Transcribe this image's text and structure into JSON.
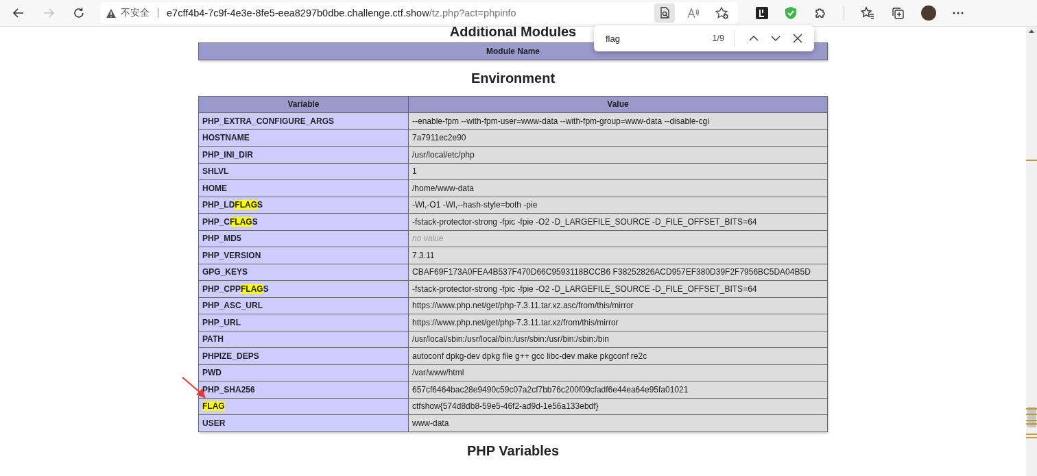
{
  "browser": {
    "nav": [
      {
        "kind": "back",
        "disabled": false
      },
      {
        "kind": "forward",
        "disabled": true
      },
      {
        "kind": "reload",
        "disabled": false
      }
    ],
    "address": {
      "security": "不安全",
      "host": "e7cff4b4-7c9f-4e3e-8fe5-eea8297b0dbe.challenge.ctf.show",
      "path": "/tz.php?act=phpinfo"
    },
    "find_bar": {
      "query": "flag",
      "count": "1/9"
    }
  },
  "page": {
    "cut_heading": "Additional Modules",
    "modules_column": "Module Name",
    "section_title": "Environment",
    "table": {
      "columns": [
        "Variable",
        "Value"
      ],
      "rows": [
        {
          "name": [
            {
              "text": "PHP_EXTRA_CONFIGURE_ARGS",
              "highlighted": false
            }
          ],
          "value": "--enable-fpm --with-fpm-user=www-data --with-fpm-group=www-data --disable-cgi",
          "kind": "text"
        },
        {
          "name": [
            {
              "text": "HOSTNAME",
              "highlighted": false
            }
          ],
          "value": "7a7911ec2e90",
          "kind": "text"
        },
        {
          "name": [
            {
              "text": "PHP_INI_DIR",
              "highlighted": false
            }
          ],
          "value": "/usr/local/etc/php",
          "kind": "text"
        },
        {
          "name": [
            {
              "text": "SHLVL",
              "highlighted": false
            }
          ],
          "value": "1",
          "kind": "text"
        },
        {
          "name": [
            {
              "text": "HOME",
              "highlighted": false
            }
          ],
          "value": "/home/www-data",
          "kind": "text"
        },
        {
          "name": [
            {
              "text": "PHP_LD",
              "highlighted": false
            },
            {
              "text": "FLAG",
              "highlighted": true
            },
            {
              "text": "S",
              "highlighted": false
            }
          ],
          "value": "-Wl,-O1 -Wl,--hash-style=both -pie",
          "kind": "text"
        },
        {
          "name": [
            {
              "text": "PHP_C",
              "highlighted": false
            },
            {
              "text": "FLAG",
              "highlighted": true
            },
            {
              "text": "S",
              "highlighted": false
            }
          ],
          "value": "-fstack-protector-strong -fpic -fpie -O2 -D_LARGEFILE_SOURCE -D_FILE_OFFSET_BITS=64",
          "kind": "text"
        },
        {
          "name": [
            {
              "text": "PHP_MD5",
              "highlighted": false
            }
          ],
          "value": "no value",
          "kind": "no_value"
        },
        {
          "name": [
            {
              "text": "PHP_VERSION",
              "highlighted": false
            }
          ],
          "value": "7.3.11",
          "kind": "text"
        },
        {
          "name": [
            {
              "text": "GPG_KEYS",
              "highlighted": false
            }
          ],
          "value": "CBAF69F173A0FEA4B537F470D66C9593118BCCB6 F38252826ACD957EF380D39F2F7956BC5DA04B5D",
          "kind": "text"
        },
        {
          "name": [
            {
              "text": "PHP_CPP",
              "highlighted": false
            },
            {
              "text": "FLAG",
              "highlighted": true
            },
            {
              "text": "S",
              "highlighted": false
            }
          ],
          "value": "-fstack-protector-strong -fpic -fpie -O2 -D_LARGEFILE_SOURCE -D_FILE_OFFSET_BITS=64",
          "kind": "text"
        },
        {
          "name": [
            {
              "text": "PHP_ASC_URL",
              "highlighted": false
            }
          ],
          "value": "https://www.php.net/get/php-7.3.11.tar.xz.asc/from/this/mirror",
          "kind": "text"
        },
        {
          "name": [
            {
              "text": "PHP_URL",
              "highlighted": false
            }
          ],
          "value": "https://www.php.net/get/php-7.3.11.tar.xz/from/this/mirror",
          "kind": "text"
        },
        {
          "name": [
            {
              "text": "PATH",
              "highlighted": false
            }
          ],
          "value": "/usr/local/sbin:/usr/local/bin:/usr/sbin:/usr/bin:/sbin:/bin",
          "kind": "text"
        },
        {
          "name": [
            {
              "text": "PHPIZE_DEPS",
              "highlighted": false
            }
          ],
          "value": "autoconf dpkg-dev dpkg file g++ gcc libc-dev make pkgconf re2c",
          "kind": "text"
        },
        {
          "name": [
            {
              "text": "PWD",
              "highlighted": false
            }
          ],
          "value": "/var/www/html",
          "kind": "text"
        },
        {
          "name": [
            {
              "text": "PHP_SHA256",
              "highlighted": false
            }
          ],
          "value": "657cf6464bac28e9490c59c07a2cf7bb76c200f09cfadf6e44ea64e95fa01021",
          "kind": "text"
        },
        {
          "name": [
            {
              "text": "FLAG",
              "highlighted": true
            }
          ],
          "value": "ctfshow{574d8db8-59e5-46f2-ad9d-1e56a133ebdf}",
          "kind": "text"
        },
        {
          "name": [
            {
              "text": "USER",
              "highlighted": false
            }
          ],
          "value": "www-data",
          "kind": "text"
        }
      ]
    },
    "next_heading": "PHP Variables"
  }
}
